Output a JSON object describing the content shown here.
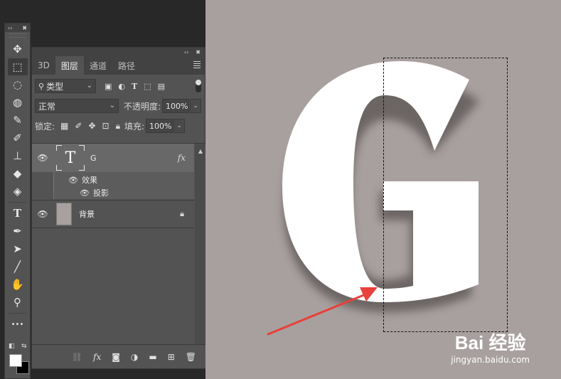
{
  "toolbar": {
    "tools": [
      {
        "name": "move-tool",
        "glyph": "✥"
      },
      {
        "name": "marquee-tool",
        "glyph": "⬚"
      },
      {
        "name": "lasso-tool",
        "glyph": "◌"
      },
      {
        "name": "quick-select-tool",
        "glyph": "◍"
      },
      {
        "name": "eyedropper-tool",
        "glyph": "✎"
      },
      {
        "name": "brush-tool",
        "glyph": "✐"
      },
      {
        "name": "stamp-tool",
        "glyph": "⊥"
      },
      {
        "name": "eraser-tool",
        "glyph": "◆"
      },
      {
        "name": "paint-bucket-tool",
        "glyph": "◈"
      },
      {
        "name": "type-tool",
        "glyph": "T"
      },
      {
        "name": "pen-tool",
        "glyph": "✒"
      },
      {
        "name": "path-select-tool",
        "glyph": "➤"
      },
      {
        "name": "line-tool",
        "glyph": "╱"
      },
      {
        "name": "hand-tool",
        "glyph": "✋"
      },
      {
        "name": "zoom-tool",
        "glyph": "⚲"
      },
      {
        "name": "more-tools",
        "glyph": "•••"
      }
    ],
    "foreground_color": "#ffffff",
    "background_color": "#000000"
  },
  "panel": {
    "tabs": [
      "3D",
      "图层",
      "通道",
      "路径"
    ],
    "active_tab": "图层",
    "filter_kind": "类型",
    "blend_mode": "正常",
    "opacity_label": "不透明度:",
    "opacity_value": "100%",
    "lock_label": "锁定:",
    "fill_label": "填充:",
    "fill_value": "100%",
    "layers": {
      "text_layer": {
        "thumb_glyph": "T",
        "name": "G",
        "fx_label": "fx"
      },
      "effects_label": "效果",
      "shadow_label": "投影",
      "bg_layer": {
        "name": "背景"
      }
    }
  },
  "canvas": {
    "color": "#a8a09f",
    "letter": "G",
    "letter_color": "#ffffff",
    "arrow_color": "#e8403a"
  },
  "watermark": {
    "brand": "Bai  经验",
    "url": "jingyan.baidu.com"
  }
}
